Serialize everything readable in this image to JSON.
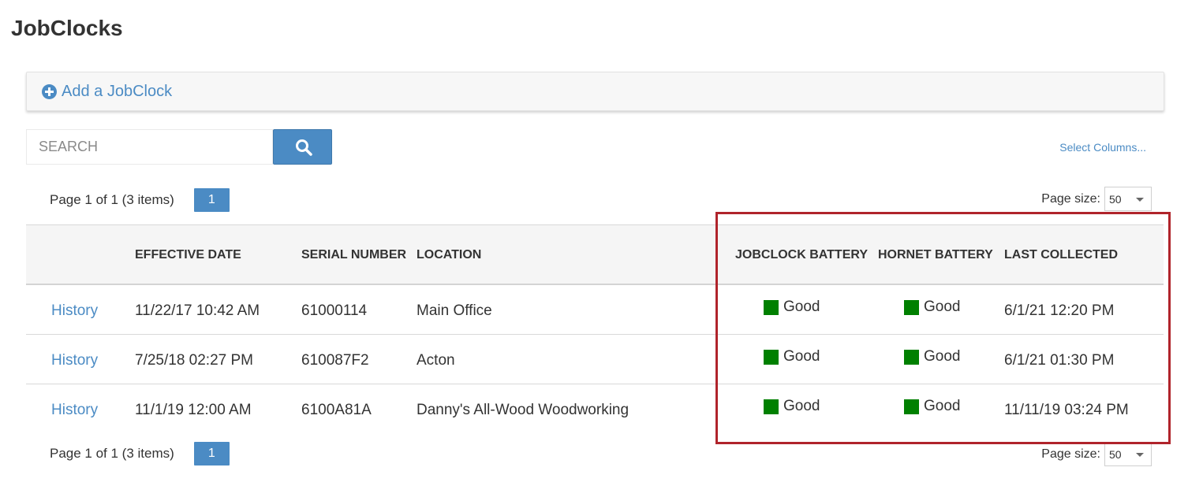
{
  "page": {
    "title": "JobClocks"
  },
  "add_panel": {
    "label": "Add a JobClock",
    "icon": "plus-circle-icon"
  },
  "search": {
    "placeholder": "SEARCH",
    "value": "",
    "button_icon": "search-icon"
  },
  "select_columns": {
    "label": "Select Columns..."
  },
  "pager": {
    "summary": "Page 1 of 1 (3 items)",
    "current_page": "1"
  },
  "page_size": {
    "label": "Page size:",
    "value": "50"
  },
  "table": {
    "columns": [
      "",
      "EFFECTIVE DATE",
      "SERIAL NUMBER",
      "LOCATION",
      "JOBCLOCK BATTERY",
      "HORNET BATTERY",
      "LAST COLLECTED"
    ],
    "rows": [
      {
        "link": "History",
        "effective_date": "11/22/17 10:42 AM",
        "serial": "61000114",
        "location": "Main Office",
        "jobclock_battery": "Good",
        "hornet_battery": "Good",
        "last_collected": "6/1/21 12:20 PM"
      },
      {
        "link": "History",
        "effective_date": "7/25/18 02:27 PM",
        "serial": "610087F2",
        "location": "Acton",
        "jobclock_battery": "Good",
        "hornet_battery": "Good",
        "last_collected": "6/1/21 01:30 PM"
      },
      {
        "link": "History",
        "effective_date": "11/1/19 12:00 AM",
        "serial": "6100A81A",
        "location": "Danny's All-Wood Woodworking",
        "jobclock_battery": "Good",
        "hornet_battery": "Good",
        "last_collected": "11/11/19 03:24 PM"
      }
    ]
  },
  "colors": {
    "accent": "#4b8bc4",
    "status_good": "#008000",
    "highlight": "#b0242b"
  }
}
